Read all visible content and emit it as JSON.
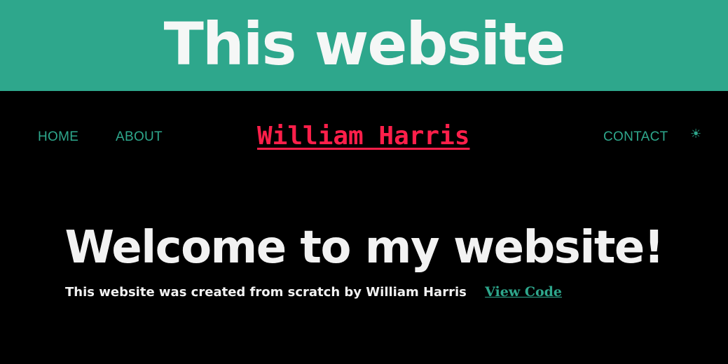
{
  "banner": {
    "title": "This website",
    "background_color": "#2ea78c"
  },
  "nav": {
    "home_label": "HOME",
    "about_label": "ABOUT",
    "contact_label": "CONTACT",
    "theme_toggle_icon": "sun-icon",
    "theme_toggle_glyph": "☀",
    "link_color": "#2ea78c"
  },
  "brand": {
    "name": "William Harris",
    "color": "#ff1f4a"
  },
  "hero": {
    "title": "Welcome to my website!",
    "subtitle": "This website was created from scratch by William Harris",
    "view_code_label": "View Code"
  }
}
